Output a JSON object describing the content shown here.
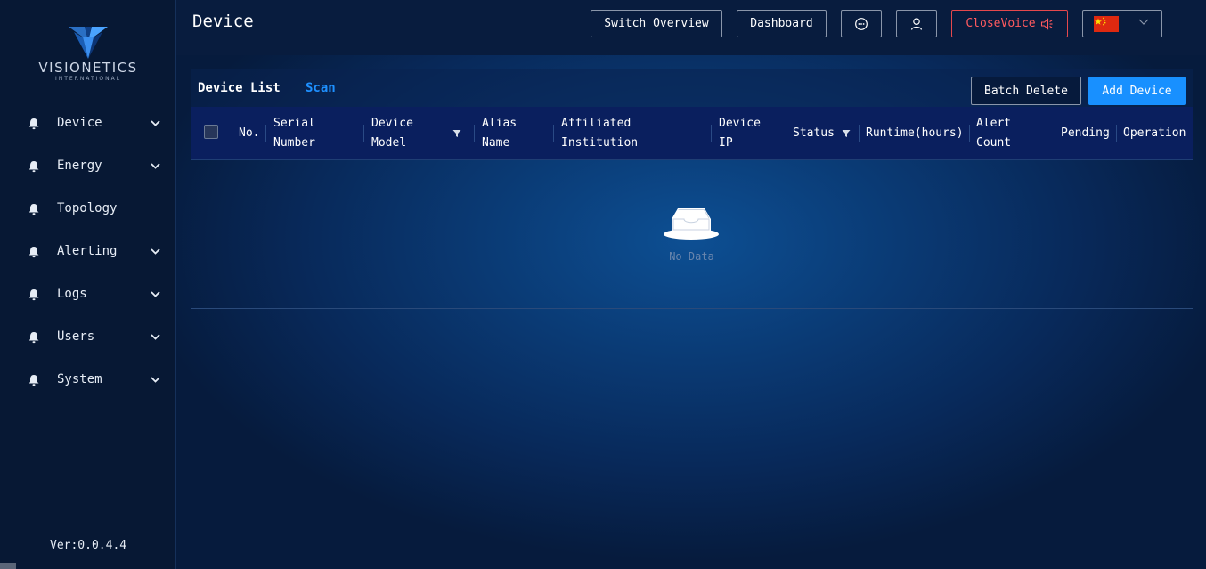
{
  "brand": {
    "name": "VISIONETICS",
    "tagline": "INTERNATIONAL"
  },
  "sidebar": {
    "items": [
      {
        "label": "Device",
        "has_submenu": true,
        "icon": "bell-icon"
      },
      {
        "label": "Energy",
        "has_submenu": true,
        "icon": "bell-icon"
      },
      {
        "label": "Topology",
        "has_submenu": false,
        "icon": "bell-icon"
      },
      {
        "label": "Alerting",
        "has_submenu": true,
        "icon": "bell-icon"
      },
      {
        "label": "Logs",
        "has_submenu": true,
        "icon": "bell-icon"
      },
      {
        "label": "Users",
        "has_submenu": true,
        "icon": "bell-icon"
      },
      {
        "label": "System",
        "has_submenu": true,
        "icon": "bell-icon"
      }
    ],
    "version": "Ver:0.0.4.4"
  },
  "header": {
    "title": "Device",
    "switch_overview": "Switch Overview",
    "dashboard": "Dashboard",
    "message_icon": "chat-bubble-icon",
    "user_icon": "user-icon",
    "close_voice": "CloseVoice",
    "voice_icon": "speaker-icon",
    "language_flag": "china-flag-icon"
  },
  "device_list": {
    "tab_active": "Device List",
    "tab_scan": "Scan",
    "batch_delete": "Batch Delete",
    "add_device": "Add Device",
    "columns": [
      {
        "label": "No.",
        "filter": false
      },
      {
        "label": "Serial\nNumber",
        "filter": false
      },
      {
        "label": "Device\nModel",
        "filter": true
      },
      {
        "label": "Alias\nName",
        "filter": false
      },
      {
        "label": "Affiliated\nInstitution",
        "filter": false
      },
      {
        "label": "Device\nIP",
        "filter": false
      },
      {
        "label": "Status",
        "filter": true
      },
      {
        "label": "Runtime(hours)",
        "filter": false
      },
      {
        "label": "Alert\nCount",
        "filter": false
      },
      {
        "label": "Pending",
        "filter": false
      },
      {
        "label": "Operation",
        "filter": false
      }
    ],
    "rows": [],
    "empty_text": "No Data"
  },
  "colors": {
    "accent": "#1890ff",
    "danger": "#ff5a5f",
    "sidebar_bg": "#071834",
    "table_header_bg": "#0a1f5e"
  }
}
